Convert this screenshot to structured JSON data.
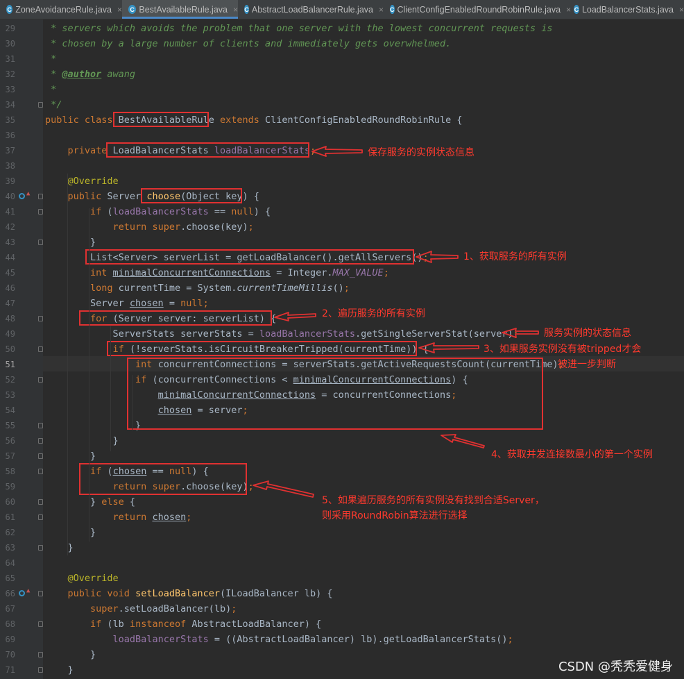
{
  "tabs": [
    {
      "label": "ZoneAvoidanceRule.java",
      "active": false
    },
    {
      "label": "BestAvailableRule.java",
      "active": true
    },
    {
      "label": "AbstractLoadBalancerRule.java",
      "active": false
    },
    {
      "label": "ClientConfigEnabledRoundRobinRule.java",
      "active": false
    },
    {
      "label": "LoadBalancerStats.java",
      "active": false
    }
  ],
  "tab_close_glyph": "×",
  "tab_icon_letter": "C",
  "current_line": "51",
  "code_lines": [
    {
      "n": "29",
      "t": [
        [
          "cm",
          " * servers which avoids the problem that one server with the lowest concurrent requests is"
        ]
      ]
    },
    {
      "n": "30",
      "t": [
        [
          "cm",
          " * chosen by a large number of clients and immediately gets overwhelmed."
        ]
      ]
    },
    {
      "n": "31",
      "t": [
        [
          "cm",
          " *"
        ]
      ]
    },
    {
      "n": "32",
      "t": [
        [
          "cm",
          " * "
        ],
        [
          "tag",
          "@author"
        ],
        [
          "cm",
          " awang"
        ]
      ]
    },
    {
      "n": "33",
      "t": [
        [
          "cm",
          " *"
        ]
      ]
    },
    {
      "n": "34",
      "t": [
        [
          "cm",
          " */"
        ]
      ]
    },
    {
      "n": "35",
      "t": [
        [
          "kw",
          "public class "
        ],
        [
          "",
          "BestAvailableRule "
        ],
        [
          "kw",
          "extends "
        ],
        [
          "",
          "ClientConfigEnabledRoundRobinRule {"
        ]
      ]
    },
    {
      "n": "36",
      "t": []
    },
    {
      "n": "37",
      "t": [
        [
          "",
          "    "
        ],
        [
          "kw",
          "private "
        ],
        [
          "",
          "LoadBalancerStats "
        ],
        [
          "fld",
          "loadBalancerStats"
        ],
        [
          "kw",
          ";"
        ]
      ]
    },
    {
      "n": "38",
      "t": []
    },
    {
      "n": "39",
      "t": [
        [
          "",
          "    "
        ],
        [
          "an",
          "@Override"
        ]
      ]
    },
    {
      "n": "40",
      "t": [
        [
          "",
          "    "
        ],
        [
          "kw",
          "public "
        ],
        [
          "",
          "Server "
        ],
        [
          "mdecl",
          "choose"
        ],
        [
          "",
          "(Object key) {"
        ]
      ]
    },
    {
      "n": "41",
      "t": [
        [
          "",
          "        "
        ],
        [
          "kw",
          "if "
        ],
        [
          "",
          "("
        ],
        [
          "fld",
          "loadBalancerStats"
        ],
        [
          "",
          " == "
        ],
        [
          "kw",
          "null"
        ],
        [
          "",
          ") {"
        ]
      ]
    },
    {
      "n": "42",
      "t": [
        [
          "",
          "            "
        ],
        [
          "kw",
          "return super"
        ],
        [
          "",
          ".choose(key)"
        ],
        [
          "kw",
          ";"
        ]
      ]
    },
    {
      "n": "43",
      "t": [
        [
          "",
          "        }"
        ]
      ]
    },
    {
      "n": "44",
      "t": [
        [
          "",
          "        List<Server> serverList = getLoadBalancer().getAllServers()"
        ],
        [
          "kw",
          ";"
        ]
      ]
    },
    {
      "n": "45",
      "t": [
        [
          "",
          "        "
        ],
        [
          "kw",
          "int "
        ],
        [
          "ul",
          "minimalConcurrentConnections"
        ],
        [
          "",
          " = Integer."
        ],
        [
          "sf",
          "MAX_VALUE"
        ],
        [
          "kw",
          ";"
        ]
      ]
    },
    {
      "n": "46",
      "t": [
        [
          "",
          "        "
        ],
        [
          "kw",
          "long "
        ],
        [
          "",
          "currentTime = System."
        ],
        [
          "it",
          "currentTimeMillis"
        ],
        [
          "",
          "()"
        ],
        [
          "kw",
          ";"
        ]
      ]
    },
    {
      "n": "47",
      "t": [
        [
          "",
          "        Server "
        ],
        [
          "ul",
          "chosen"
        ],
        [
          "",
          " = "
        ],
        [
          "kw",
          "null;"
        ]
      ]
    },
    {
      "n": "48",
      "t": [
        [
          "",
          "        "
        ],
        [
          "kw",
          "for "
        ],
        [
          "",
          "(Server server: serverList) {"
        ]
      ]
    },
    {
      "n": "49",
      "t": [
        [
          "",
          "            ServerStats serverStats = "
        ],
        [
          "fld",
          "loadBalancerStats"
        ],
        [
          "",
          ".getSingleServerStat(server)"
        ],
        [
          "kw",
          ";"
        ]
      ]
    },
    {
      "n": "50",
      "t": [
        [
          "",
          "            "
        ],
        [
          "kw",
          "if "
        ],
        [
          "",
          "(!serverStats.isCircuitBreakerTripped(currentTime)) {"
        ]
      ]
    },
    {
      "n": "51",
      "t": [
        [
          "",
          "                "
        ],
        [
          "kw",
          "int "
        ],
        [
          "",
          "concurrentConnections = serverStats.getActiveRequestsCount(currentTime)"
        ],
        [
          "kw",
          ";"
        ]
      ]
    },
    {
      "n": "52",
      "t": [
        [
          "",
          "                "
        ],
        [
          "kw",
          "if "
        ],
        [
          "",
          "(concurrentConnections < "
        ],
        [
          "ul",
          "minimalConcurrentConnections"
        ],
        [
          "",
          ") {"
        ]
      ]
    },
    {
      "n": "53",
      "t": [
        [
          "",
          "                    "
        ],
        [
          "ul",
          "minimalConcurrentConnections"
        ],
        [
          "",
          " = concurrentConnections"
        ],
        [
          "kw",
          ";"
        ]
      ]
    },
    {
      "n": "54",
      "t": [
        [
          "",
          "                    "
        ],
        [
          "ul",
          "chosen"
        ],
        [
          "",
          " = server"
        ],
        [
          "kw",
          ";"
        ]
      ]
    },
    {
      "n": "55",
      "t": [
        [
          "",
          "                }"
        ]
      ]
    },
    {
      "n": "56",
      "t": [
        [
          "",
          "            }"
        ]
      ]
    },
    {
      "n": "57",
      "t": [
        [
          "",
          "        }"
        ]
      ]
    },
    {
      "n": "58",
      "t": [
        [
          "",
          "        "
        ],
        [
          "kw",
          "if "
        ],
        [
          "",
          "("
        ],
        [
          "ul",
          "chosen"
        ],
        [
          "",
          " == "
        ],
        [
          "kw",
          "null"
        ],
        [
          "",
          ") {"
        ]
      ]
    },
    {
      "n": "59",
      "t": [
        [
          "",
          "            "
        ],
        [
          "kw",
          "return super"
        ],
        [
          "",
          ".choose(key)"
        ],
        [
          "kw",
          ";"
        ]
      ]
    },
    {
      "n": "60",
      "t": [
        [
          "",
          "        } "
        ],
        [
          "kw",
          "else "
        ],
        [
          "",
          "{"
        ]
      ]
    },
    {
      "n": "61",
      "t": [
        [
          "",
          "            "
        ],
        [
          "kw",
          "return "
        ],
        [
          "ul",
          "chosen"
        ],
        [
          "kw",
          ";"
        ]
      ]
    },
    {
      "n": "62",
      "t": [
        [
          "",
          "        }"
        ]
      ]
    },
    {
      "n": "63",
      "t": [
        [
          "",
          "    }"
        ]
      ]
    },
    {
      "n": "64",
      "t": []
    },
    {
      "n": "65",
      "t": [
        [
          "",
          "    "
        ],
        [
          "an",
          "@Override"
        ]
      ]
    },
    {
      "n": "66",
      "t": [
        [
          "",
          "    "
        ],
        [
          "kw",
          "public void "
        ],
        [
          "mdecl",
          "setLoadBalancer"
        ],
        [
          "",
          "(ILoadBalancer lb) {"
        ]
      ]
    },
    {
      "n": "67",
      "t": [
        [
          "",
          "        "
        ],
        [
          "kw",
          "super"
        ],
        [
          "",
          ".setLoadBalancer(lb)"
        ],
        [
          "kw",
          ";"
        ]
      ]
    },
    {
      "n": "68",
      "t": [
        [
          "",
          "        "
        ],
        [
          "kw",
          "if "
        ],
        [
          "",
          "(lb "
        ],
        [
          "kw",
          "instanceof "
        ],
        [
          "",
          "AbstractLoadBalancer) {"
        ]
      ]
    },
    {
      "n": "69",
      "t": [
        [
          "",
          "            "
        ],
        [
          "fld",
          "loadBalancerStats"
        ],
        [
          "",
          " = ((AbstractLoadBalancer) lb).getLoadBalancerStats()"
        ],
        [
          "kw",
          ";"
        ]
      ]
    },
    {
      "n": "70",
      "t": [
        [
          "",
          "        }"
        ]
      ]
    },
    {
      "n": "71",
      "t": [
        [
          "",
          "    }"
        ]
      ]
    }
  ],
  "annotations": {
    "note_stats": "保存服务的实例状态信息",
    "note_1": "1、获取服务的所有实例",
    "note_2": "2、遍历服务的所有实例",
    "note_state": "服务实例的状态信息",
    "note_3a": "3、如果服务实例没有被tripped才会",
    "note_3b": "被进一步判断",
    "note_4": "4、获取并发连接数最小的第一个实例",
    "note_5a": "5、如果遍历服务的所有实例没有找到合适Server，",
    "note_5b": "则采用RoundRobin算法进行选择"
  },
  "watermark": "CSDN @秃秃爱健身",
  "colors": {
    "annotation_red": "#e03131",
    "background": "#2b2b2b",
    "keyword": "#cc7832",
    "comment": "#629755",
    "field": "#9876aa"
  }
}
